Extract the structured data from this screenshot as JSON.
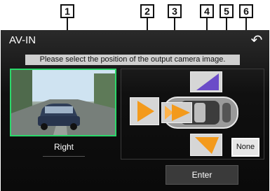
{
  "callouts": [
    "1",
    "2",
    "3",
    "4",
    "5",
    "6"
  ],
  "screen": {
    "title": "AV-IN",
    "message": "Please select the position of the output camera image.",
    "preview_label": "Right",
    "none_label": "None",
    "enter_label": "Enter"
  },
  "colors": {
    "selection_border": "#2bd86a",
    "arrow_orange": "#f39a1c",
    "arrow_purple": "#6b4cc8"
  }
}
